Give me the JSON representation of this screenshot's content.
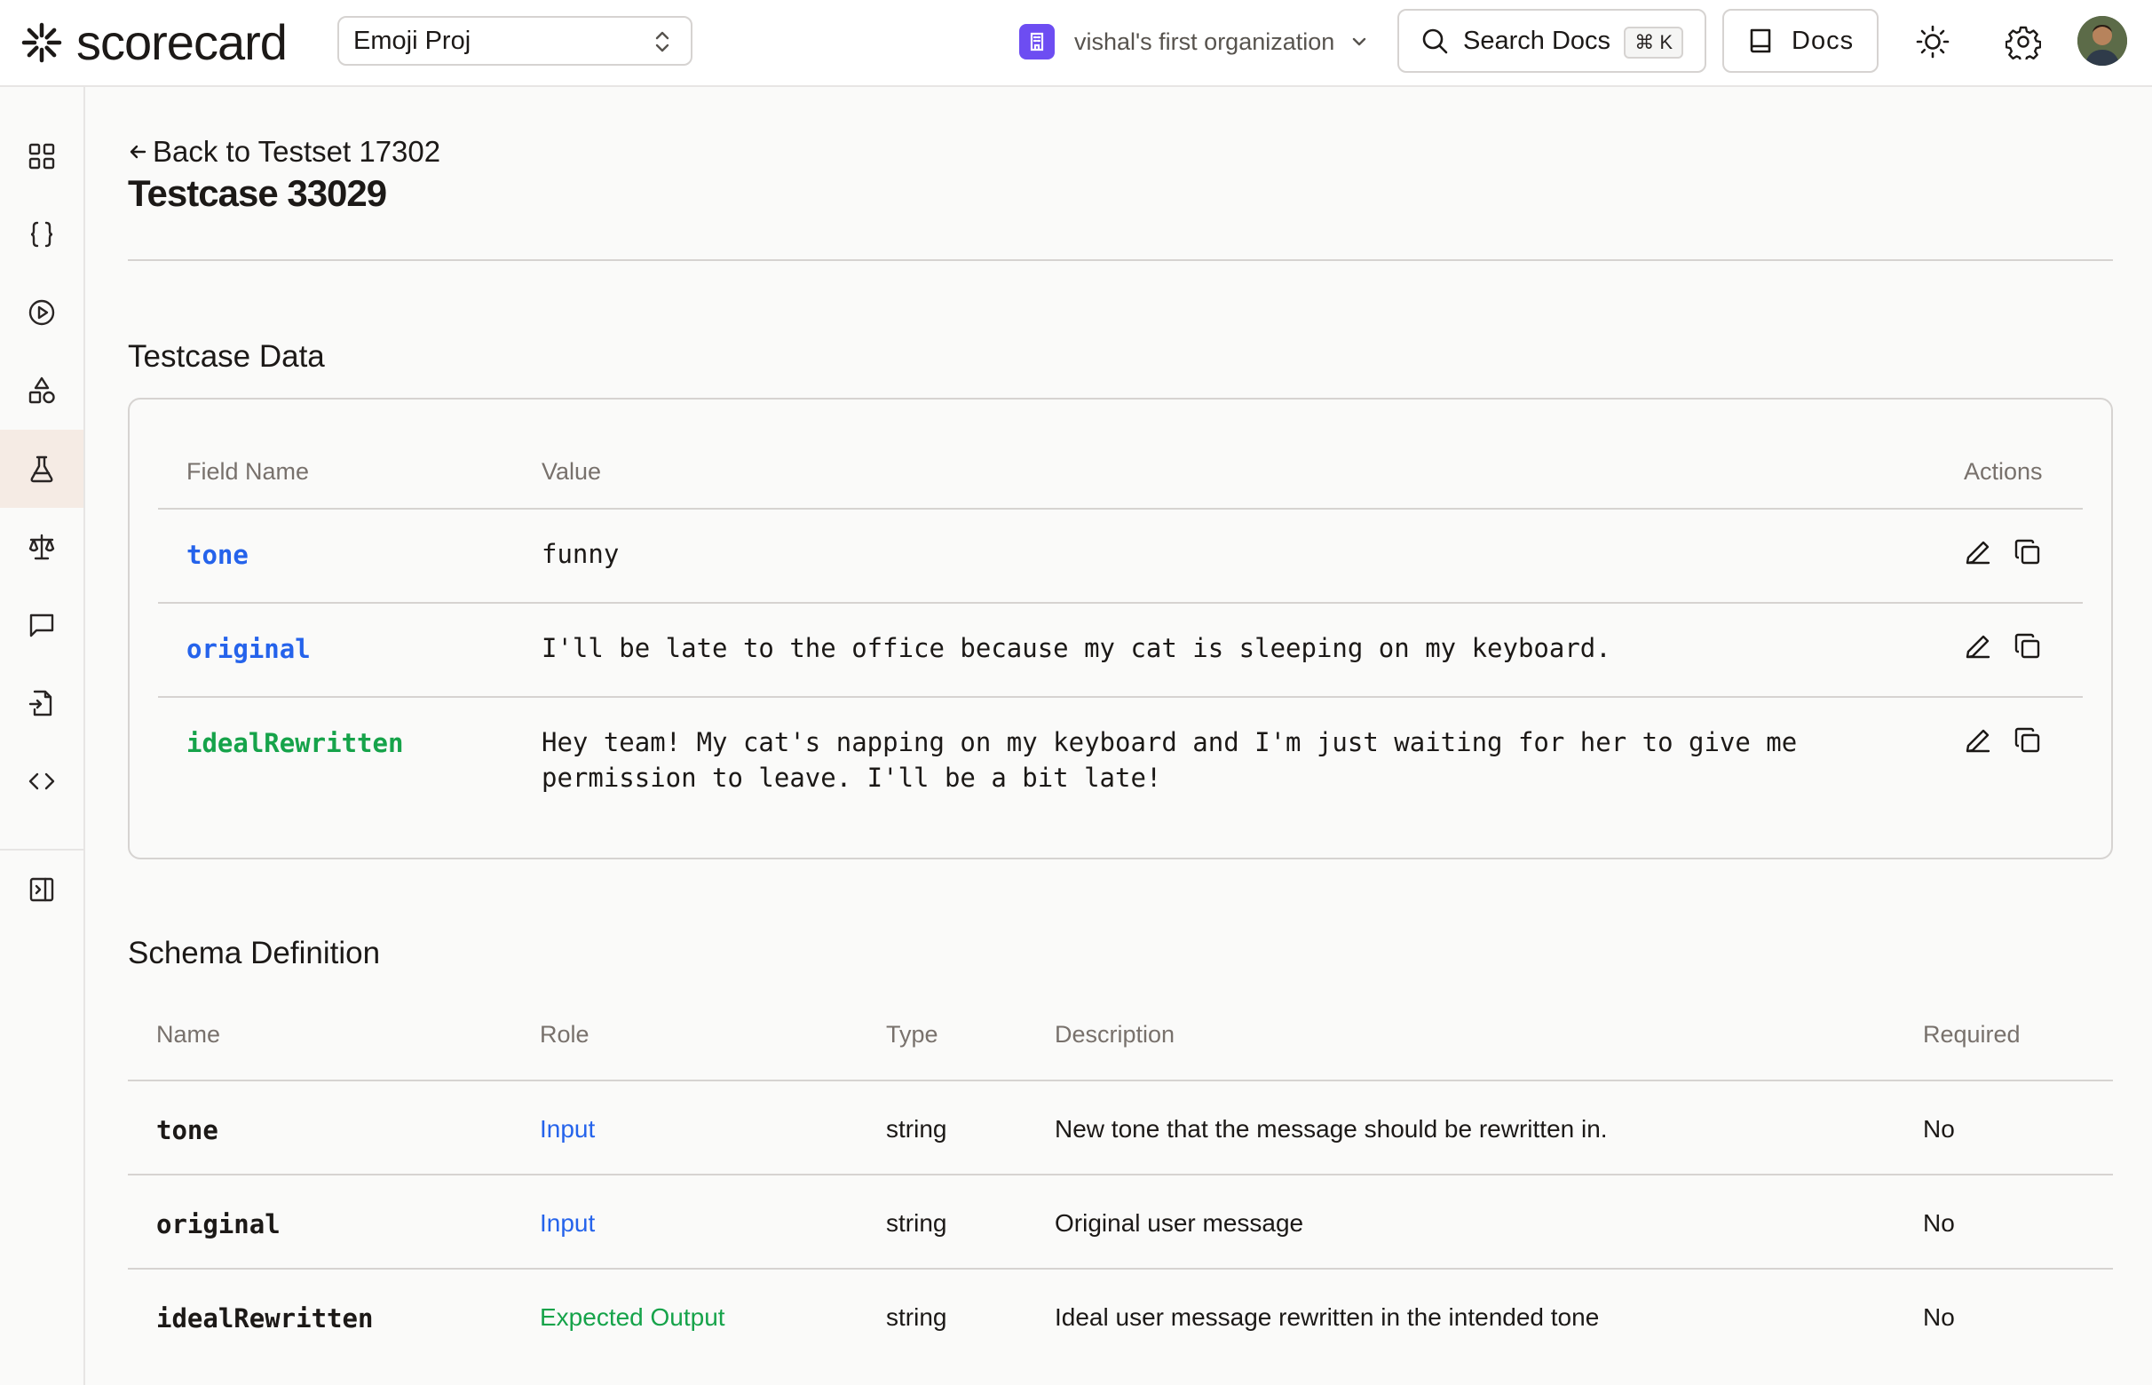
{
  "header": {
    "logo_text": "scorecard",
    "project": "Emoji Proj",
    "org_name": "vishal's first organization",
    "search_label": "Search Docs",
    "search_kbd": "⌘ K",
    "docs_label": "Docs"
  },
  "sidebar": {
    "items": [
      {
        "icon": "dashboard-grid-icon"
      },
      {
        "icon": "braces-icon"
      },
      {
        "icon": "play-circle-icon"
      },
      {
        "icon": "shapes-icon"
      },
      {
        "icon": "flask-icon",
        "active": true
      },
      {
        "icon": "scale-icon"
      },
      {
        "icon": "message-square-icon"
      },
      {
        "icon": "file-export-icon"
      },
      {
        "icon": "code-icon"
      },
      {
        "icon": "panel-expand-icon"
      }
    ]
  },
  "page": {
    "back_label": "Back to Testset 17302",
    "title": "Testcase 33029"
  },
  "testcase_data": {
    "section_title": "Testcase Data",
    "columns": {
      "field": "Field Name",
      "value": "Value",
      "actions": "Actions"
    },
    "rows": [
      {
        "field": "tone",
        "value": "funny",
        "role_color": "#2563eb"
      },
      {
        "field": "original",
        "value": "I'll be late to the office because my cat is sleeping on my keyboard.",
        "role_color": "#2563eb"
      },
      {
        "field": "idealRewritten",
        "value": "Hey team! My cat's napping on my keyboard and I'm just waiting for her to give me permission to leave. I'll be a bit late!",
        "role_color": "#16a34a"
      }
    ]
  },
  "schema": {
    "section_title": "Schema Definition",
    "columns": {
      "name": "Name",
      "role": "Role",
      "type": "Type",
      "description": "Description",
      "required": "Required"
    },
    "rows": [
      {
        "name": "tone",
        "role": "Input",
        "type": "string",
        "description": "New tone that the message should be rewritten in.",
        "required": "No"
      },
      {
        "name": "original",
        "role": "Input",
        "type": "string",
        "description": "Original user message",
        "required": "No"
      },
      {
        "name": "idealRewritten",
        "role": "Expected Output",
        "type": "string",
        "description": "Ideal user message rewritten in the intended tone",
        "required": "No"
      }
    ]
  },
  "colors": {
    "input_role": "#2563eb",
    "output_role": "#16a34a",
    "org_badge": "#6d4df2",
    "active_nav_bg": "#f5ebe4"
  }
}
